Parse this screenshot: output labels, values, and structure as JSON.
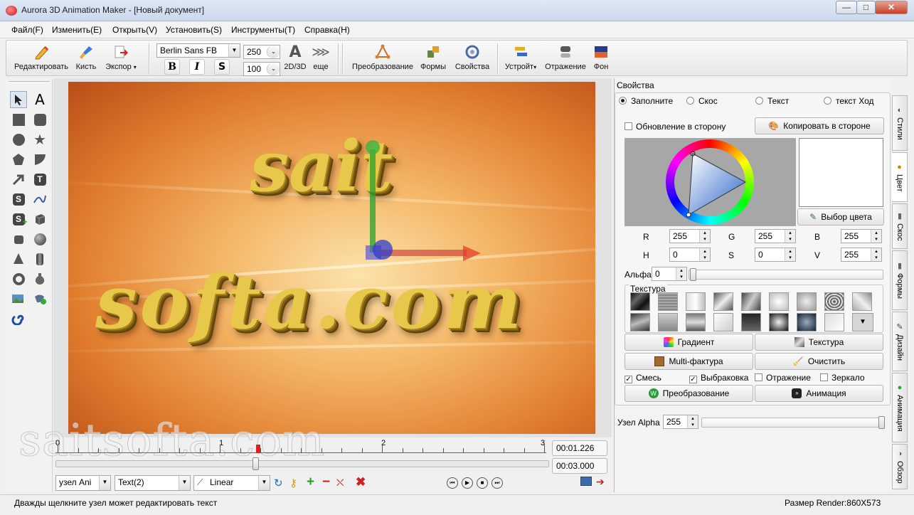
{
  "window": {
    "title": "Aurora 3D Animation Maker - [Новый документ]",
    "minimize": "—",
    "maximize": "□",
    "close": "✕"
  },
  "menu": [
    "Файл(F)",
    "Изменить(E)",
    "Открыть(V)",
    "Установить(S)",
    "Инструменты(T)",
    "Справка(H)"
  ],
  "toolbar": {
    "edit": "Редактировать",
    "brush": "Кисть",
    "export": "Экспор",
    "font": "Berlin Sans FB",
    "size1": "250",
    "size2": "100",
    "bold": "B",
    "italic": "I",
    "shadow": "S",
    "mode_2d3d": "2D/3D",
    "more": "еще",
    "transform": "Преобразование",
    "shapes": "Формы",
    "properties": "Свойства",
    "device": "Устройт",
    "reflection": "Отражение",
    "background": "Фон"
  },
  "scene": {
    "line1": "sait",
    "line2": "softa.com",
    "watermark": "saitsofta.com",
    "colors": {
      "bg_center": "#fbe3ab",
      "bg_edge": "#b84d18",
      "gold": "#e7c84a"
    }
  },
  "timeline": {
    "marks": [
      "0",
      "1",
      "2",
      "3"
    ],
    "current_time": "00:01.226",
    "total_time": "00:03.000",
    "node_type": "узел Ani",
    "text_item": "Text(2)",
    "interpolation": "Linear"
  },
  "props": {
    "title": "Свойства",
    "modes": [
      "Заполните",
      "Скос",
      "Текст",
      "текст Ход"
    ],
    "selected_mode": 0,
    "update_side": "Обновление в сторону",
    "copy_side": "Копировать в стороне",
    "pick_color": "Выбор цвета",
    "r_label": "R",
    "r": "255",
    "g_label": "G",
    "g": "255",
    "b_label": "B",
    "b": "255",
    "h_label": "H",
    "h": "0",
    "s_label": "S",
    "s": "0",
    "v_label": "V",
    "v": "255",
    "alpha_label": "Альфа",
    "alpha": "0",
    "texture_group": "Текстура",
    "gradient": "Градиент",
    "texture": "Текстура",
    "multi": "Multi-фактура",
    "clear": "Очистить",
    "mix": "Смесь",
    "culling": "Выбраковка",
    "reflect": "Отражение",
    "mirror": "Зеркало",
    "transform": "Преобразование",
    "animation": "Анимация",
    "node_alpha_label": "Узел Alpha",
    "node_alpha": "255",
    "swatch_color": "#ffffff"
  },
  "tabs": [
    "Стили",
    "Цвет",
    "Скос",
    "Формы",
    "Дизайн",
    "Анимация",
    "Обзор"
  ],
  "status": {
    "hint": "Дважды щелкните узел может редактировать текст",
    "render_size": "Размер Render:860X573"
  }
}
